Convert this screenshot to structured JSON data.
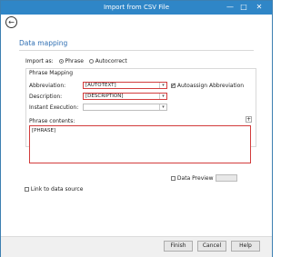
{
  "window": {
    "title": "Import from CSV File",
    "minimize_glyph": "—",
    "maximize_glyph": "□",
    "close_glyph": "✕"
  },
  "back_glyph": "←",
  "page": {
    "heading": "Data mapping"
  },
  "import_as": {
    "label": "Import as:",
    "options": [
      "Phrase",
      "Autocorrect"
    ],
    "selected": "Phrase"
  },
  "phrase_mapping": {
    "group_label": "Phrase Mapping",
    "abbreviation_label": "Abbreviation:",
    "abbreviation_value": "[AUTOTEXT]",
    "autoassign_label": "Autoassign Abbreviation",
    "autoassign_checked": true,
    "description_label": "Description:",
    "description_value": "[DESCRIPTION]",
    "instant_execution_label": "Instant Execution:",
    "instant_execution_value": ""
  },
  "phrase_contents": {
    "label": "Phrase contents:",
    "value": "[PHRASE]",
    "add_glyph": "+"
  },
  "data_preview": {
    "label": "Data Preview",
    "checked": false
  },
  "link_to_data_source": {
    "label": "Link to data source",
    "checked": false
  },
  "buttons": {
    "finish": "Finish",
    "cancel": "Cancel",
    "help": "Help"
  },
  "dropdown_glyph": "▾"
}
